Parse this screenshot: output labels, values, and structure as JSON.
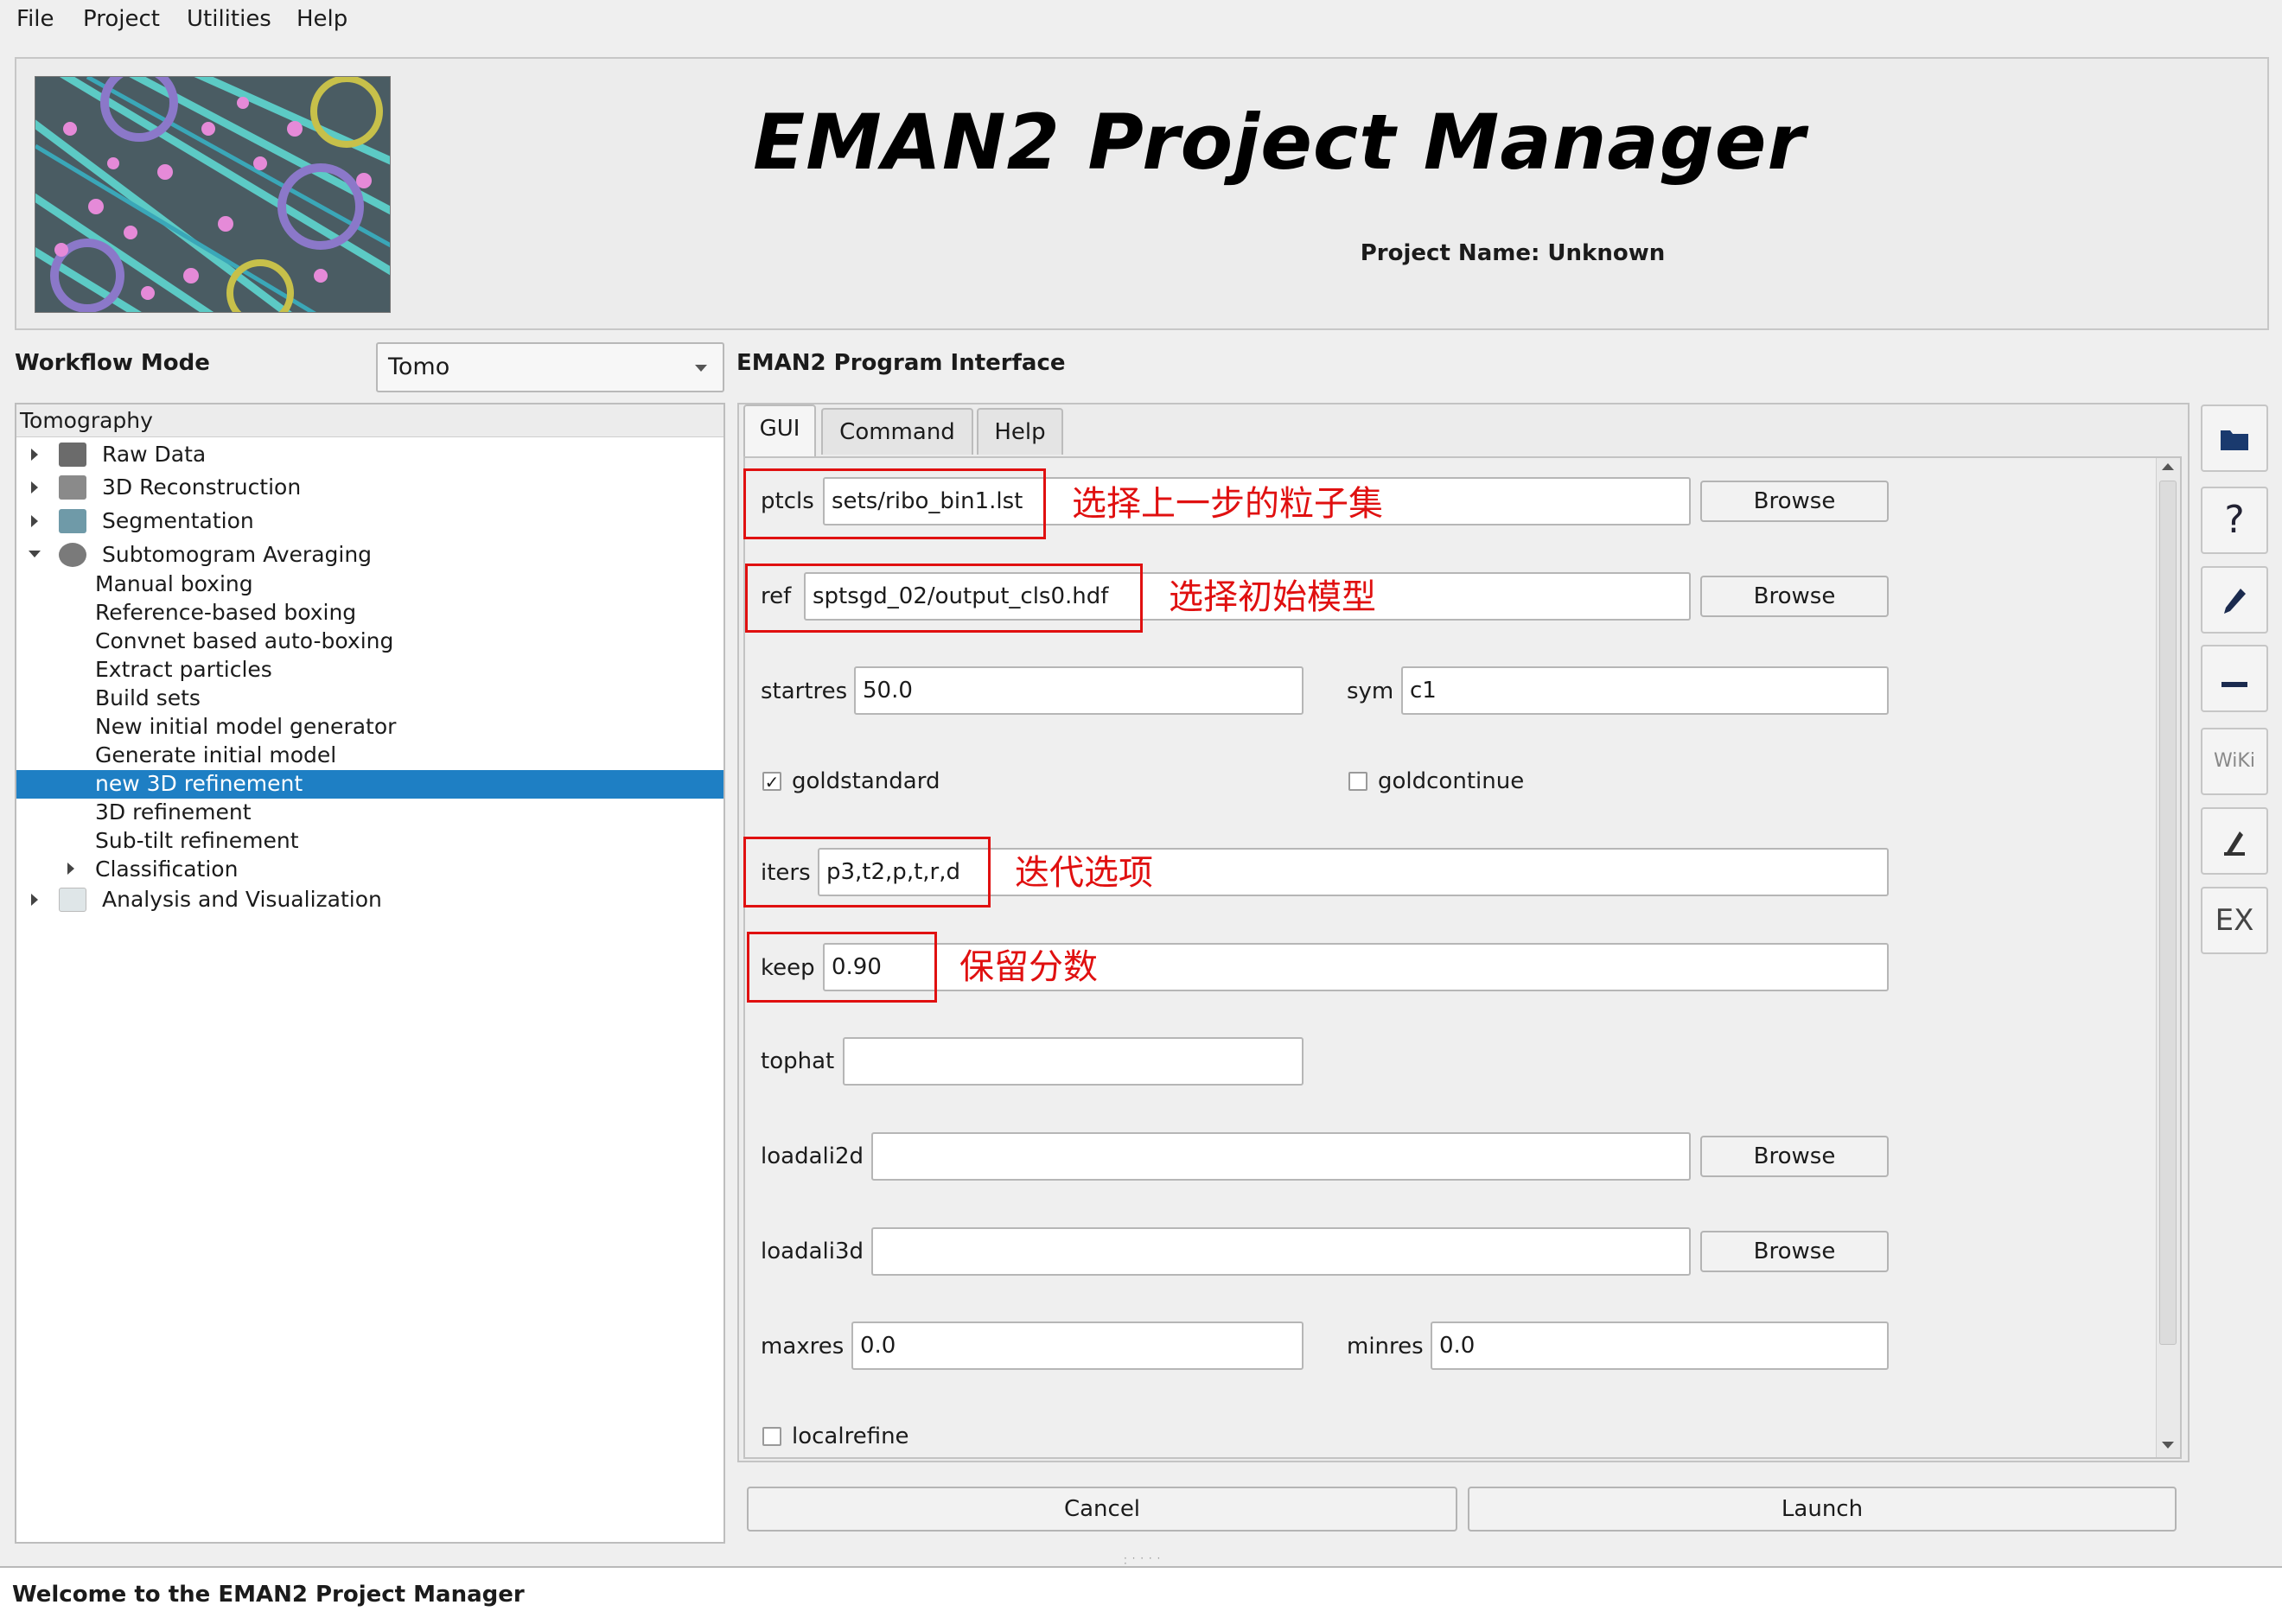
{
  "menu": [
    "File",
    "Project",
    "Utilities",
    "Help"
  ],
  "banner": {
    "title": "EMAN2 Project Manager",
    "project_name": "Project Name: Unknown"
  },
  "workflow": {
    "label": "Workflow Mode",
    "mode": "Tomo"
  },
  "program_interface_label": "EMAN2 Program Interface",
  "tree": {
    "header": "Tomography",
    "top_items": [
      "Raw Data",
      "3D Reconstruction",
      "Segmentation",
      "Subtomogram Averaging"
    ],
    "sub_items": [
      "Manual boxing",
      "Reference-based boxing",
      "Convnet based auto-boxing",
      "Extract particles",
      "Build sets",
      "New initial model generator",
      "Generate initial model",
      "new 3D refinement",
      "3D refinement",
      "Sub-tilt refinement",
      "Classification"
    ],
    "last_item": "Analysis and Visualization",
    "selected": "new 3D refinement"
  },
  "tabs": [
    "GUI",
    "Command",
    "Help"
  ],
  "form": {
    "ptcls": {
      "label": "ptcls",
      "value": "sets/ribo_bin1.lst"
    },
    "ref": {
      "label": "ref",
      "value": "sptsgd_02/output_cls0.hdf"
    },
    "startres": {
      "label": "startres",
      "value": "50.0"
    },
    "sym": {
      "label": "sym",
      "value": "c1"
    },
    "goldstandard": {
      "label": "goldstandard",
      "checked": true
    },
    "goldcontinue": {
      "label": "goldcontinue",
      "checked": false
    },
    "iters": {
      "label": "iters",
      "value": "p3,t2,p,t,r,d"
    },
    "keep": {
      "label": "keep",
      "value": "0.90"
    },
    "tophat": {
      "label": "tophat",
      "value": ""
    },
    "loadali2d": {
      "label": "loadali2d",
      "value": ""
    },
    "loadali3d": {
      "label": "loadali3d",
      "value": ""
    },
    "maxres": {
      "label": "maxres",
      "value": "0.0"
    },
    "minres": {
      "label": "minres",
      "value": "0.0"
    },
    "localrefine": {
      "label": "localrefine",
      "checked": false
    },
    "browse_label": "Browse"
  },
  "annotations": {
    "ptcls": "选择上一步的粒子集",
    "ref": "选择初始模型",
    "iters": "迭代选项",
    "keep": "保留分数"
  },
  "actions": {
    "cancel": "Cancel",
    "launch": "Launch"
  },
  "side_toolbar": {
    "wiki": "WiKi",
    "ex": "EX"
  },
  "status_text": "Welcome to the EMAN2 Project Manager",
  "colors": {
    "selection": "#1e7fc4",
    "annotation": "#e01010"
  }
}
